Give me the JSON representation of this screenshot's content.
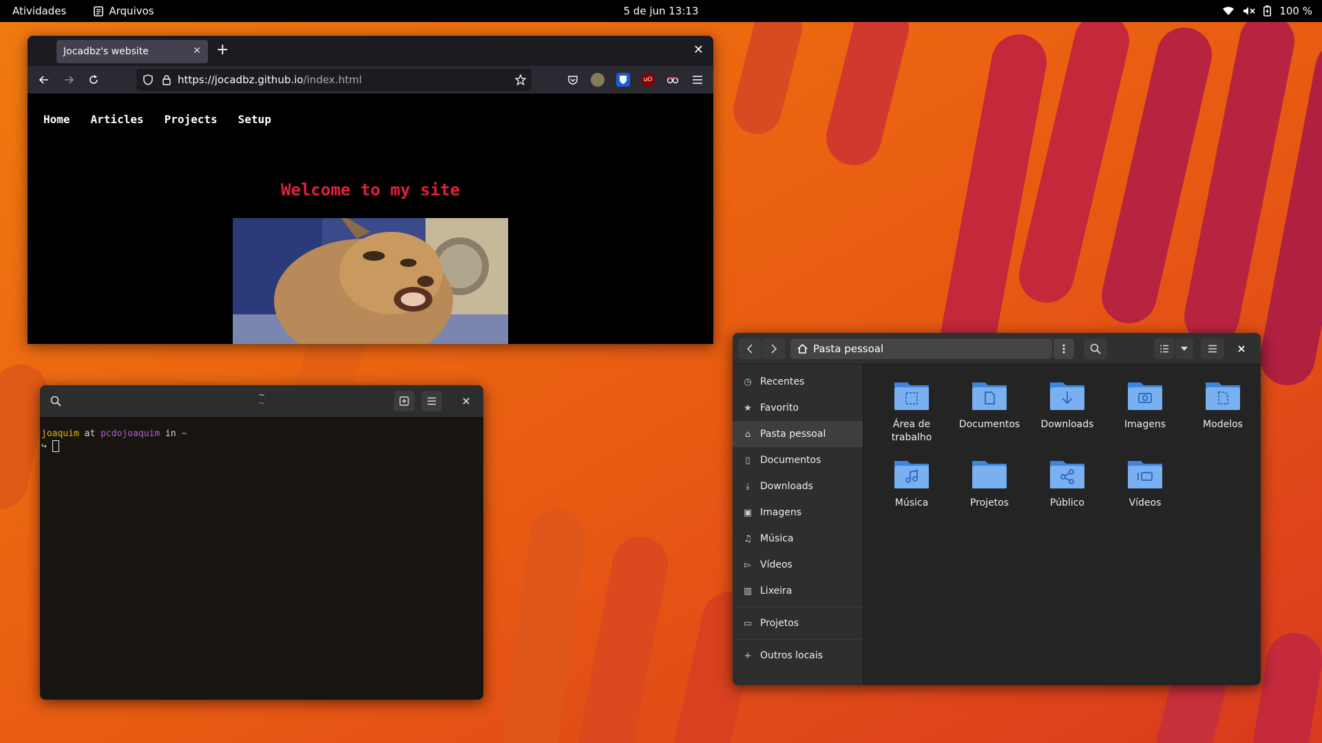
{
  "topbar": {
    "activities": "Atividades",
    "app_name": "Arquivos",
    "clock": "5 de jun  13:13",
    "battery": "100 %",
    "icons": [
      "wifi-icon",
      "volume-muted-icon",
      "battery-icon"
    ]
  },
  "firefox": {
    "tab_title": "Jocadbz's website",
    "url_host": "https://jocadbz.github.io",
    "url_path": "/index.html",
    "site_nav": [
      "Home",
      "Articles",
      "Projects",
      "Setup"
    ],
    "welcome": "Welcome to my site",
    "accent_color": "#e0213c"
  },
  "terminal": {
    "title": "~",
    "subtitle": "~",
    "user": "joaquim",
    "at": "at",
    "host": "pcdojoaquim",
    "in": "in",
    "cwd": "~",
    "prompt_arrow": "↪"
  },
  "files": {
    "path": "Pasta pessoal",
    "sidebar": [
      {
        "label": "Recentes",
        "icon": "clock-icon"
      },
      {
        "label": "Favorito",
        "icon": "star-icon"
      },
      {
        "label": "Pasta pessoal",
        "icon": "home-icon",
        "active": true
      },
      {
        "label": "Documentos",
        "icon": "document-icon"
      },
      {
        "label": "Downloads",
        "icon": "download-icon"
      },
      {
        "label": "Imagens",
        "icon": "image-icon"
      },
      {
        "label": "Música",
        "icon": "music-icon"
      },
      {
        "label": "Vídeos",
        "icon": "video-icon"
      },
      {
        "label": "Lixeira",
        "icon": "trash-icon"
      },
      {
        "label": "Projetos",
        "icon": "folder-icon"
      },
      {
        "label": "Outros locais",
        "icon": "plus-icon"
      }
    ],
    "folders": [
      {
        "label": "Área de trabalho",
        "icon": "desktop-folder-icon"
      },
      {
        "label": "Documentos",
        "icon": "documents-folder-icon"
      },
      {
        "label": "Downloads",
        "icon": "downloads-folder-icon"
      },
      {
        "label": "Imagens",
        "icon": "pictures-folder-icon"
      },
      {
        "label": "Modelos",
        "icon": "templates-folder-icon"
      },
      {
        "label": "Música",
        "icon": "music-folder-icon"
      },
      {
        "label": "Projetos",
        "icon": "folder-icon"
      },
      {
        "label": "Público",
        "icon": "public-folder-icon"
      },
      {
        "label": "Vídeos",
        "icon": "videos-folder-icon"
      }
    ],
    "folder_color": "#5b9cf0"
  }
}
